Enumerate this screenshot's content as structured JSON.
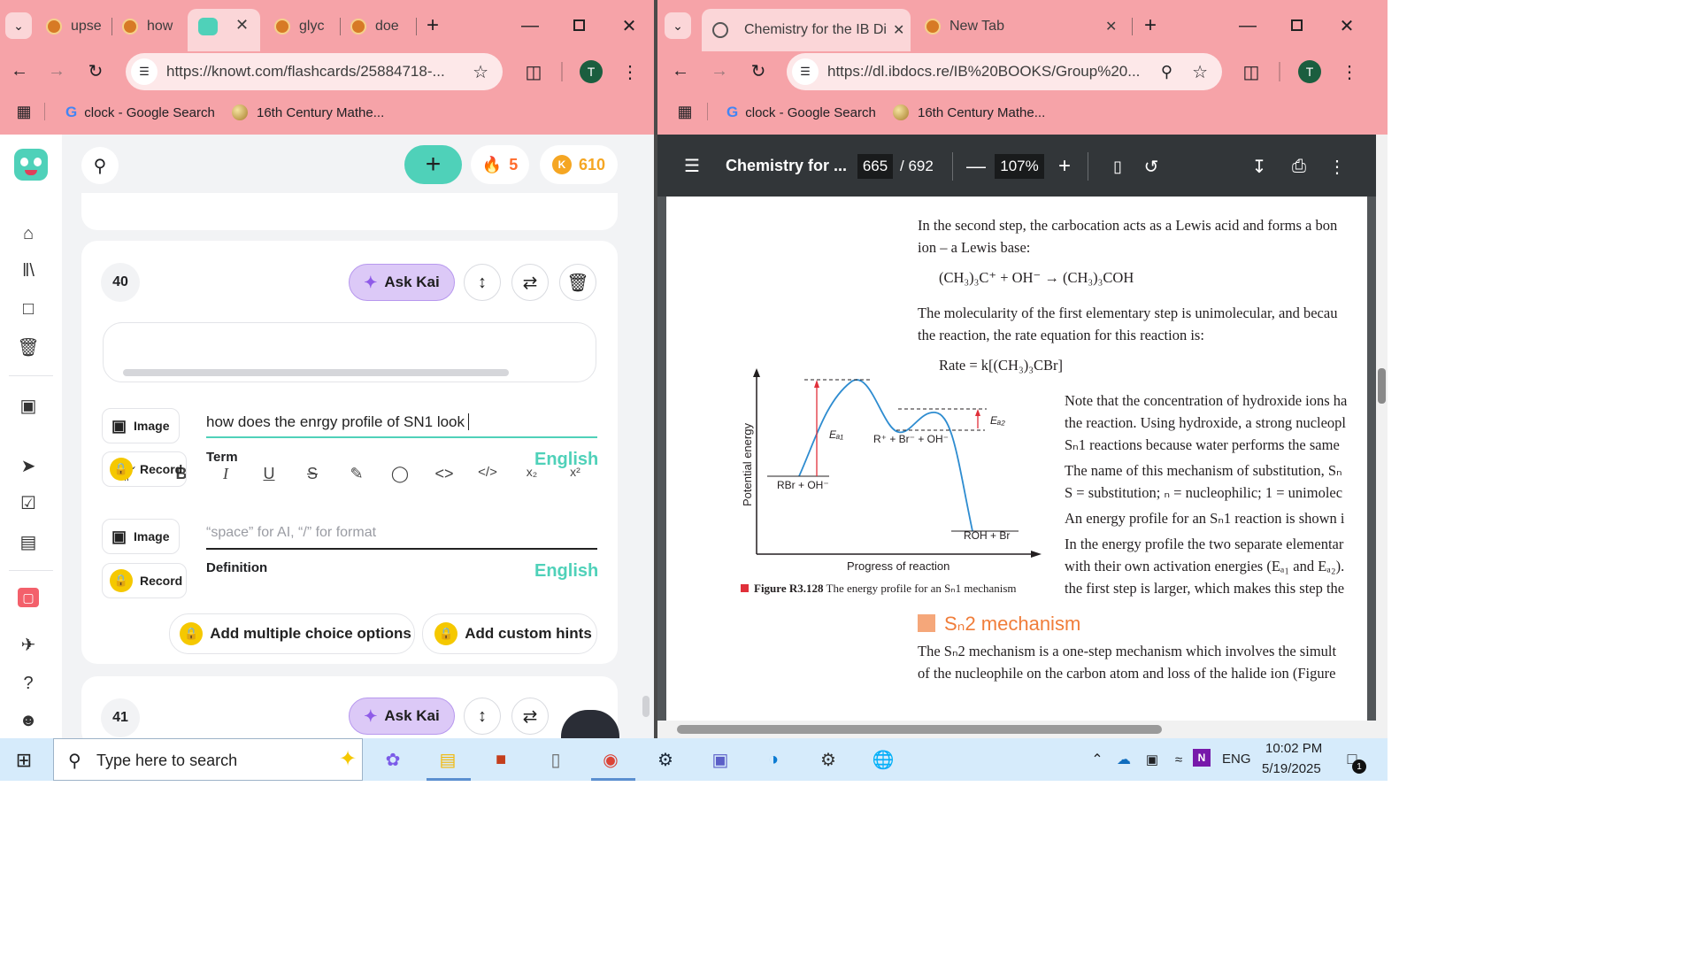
{
  "left_browser": {
    "tabs": [
      {
        "title": "upse"
      },
      {
        "title": "how"
      },
      {
        "title": ""
      },
      {
        "title": "glyc"
      },
      {
        "title": "doe"
      }
    ],
    "url": "https://knowt.com/flashcards/25884718-...",
    "avatar": "T",
    "bookmarks": [
      {
        "label": "clock - Google Search"
      },
      {
        "label": "16th Century Mathe..."
      }
    ]
  },
  "right_browser": {
    "tabs": [
      {
        "title": "Chemistry for the IB Dipl"
      },
      {
        "title": "New Tab"
      }
    ],
    "url": "https://dl.ibdocs.re/IB%20BOOKS/Group%20...",
    "avatar": "T",
    "bookmarks": [
      {
        "label": "clock - Google Search"
      },
      {
        "label": "16th Century Mathe..."
      }
    ]
  },
  "knowt": {
    "streak": "5",
    "coins": "610",
    "card_number": "40",
    "next_card_number": "41",
    "ask_kai": "Ask Kai",
    "term_text": "how does the enrgy profile of SN1 look",
    "term_label": "Term",
    "term_lang": "English",
    "definition_placeholder": "“space” for AI, “/” for format",
    "definition_label": "Definition",
    "definition_lang": "English",
    "image_label": "Image",
    "record_label": "Record",
    "add_mc": "Add multiple choice options",
    "add_hints": "Add custom hints",
    "toolbar_icons": [
      "paragraph-icon",
      "bold-icon",
      "italic-icon",
      "underline-icon",
      "strikethrough-icon",
      "highlight-icon",
      "palette-icon",
      "code-icon",
      "code-block-icon",
      "subscript-icon",
      "superscript-icon"
    ]
  },
  "pdf": {
    "title": "Chemistry for ...",
    "page": "665",
    "total": "/ 692",
    "zoom": "107%",
    "para1a": "In the second step, the carbocation acts as a Lewis acid and forms a bon",
    "para1b": "ion – a Lewis base:",
    "eq1": "(CH₃)₃C⁺ + OH⁻ → (CH₃)₃COH",
    "para2a": "The molecularity of the first elementary step is unimolecular, and becau",
    "para2b": "the reaction, the rate equation for this reaction is:",
    "rate": "Rate = k[(CH₃)₃CBr]",
    "right_col": [
      "Note that the concentration of hydroxide ions ha",
      "the reaction. Using hydroxide, a strong nucleopl",
      "Sₙ1 reactions because water performs the same",
      "The name of this mechanism of substitution, Sₙ",
      "S = substitution; ₙ = nucleophilic; 1 = unimolec",
      "An energy profile for an Sₙ1 reaction is shown i",
      "In the energy profile the two separate elementar",
      "with their own activation energies (Eₐ₁ and Eₐ₂).",
      "the first step is larger, which makes this step the"
    ],
    "chart": {
      "ylabel": "Potential energy",
      "xlabel": "Progress of reaction",
      "reactants": "RBr + OH⁻",
      "intermediate": "R⁺ + Br⁻ + OH⁻",
      "products": "ROH + Br",
      "ea1": "Eₐ₁",
      "ea2": "Eₐ₂"
    },
    "caption_bold": "Figure R3.128",
    "caption": "The energy profile for an Sₙ1 mechanism",
    "heading": "Sₙ2 mechanism",
    "para3a": "The Sₙ2 mechanism is a one-step mechanism which involves the simult",
    "para3b": "of the nucleophile on the carbon atom and loss of the halide ion (Figure"
  },
  "taskbar": {
    "search_placeholder": "Type here to search",
    "lang": "ENG",
    "time": "10:02 PM",
    "date": "5/19/2025",
    "notifications": "1"
  }
}
